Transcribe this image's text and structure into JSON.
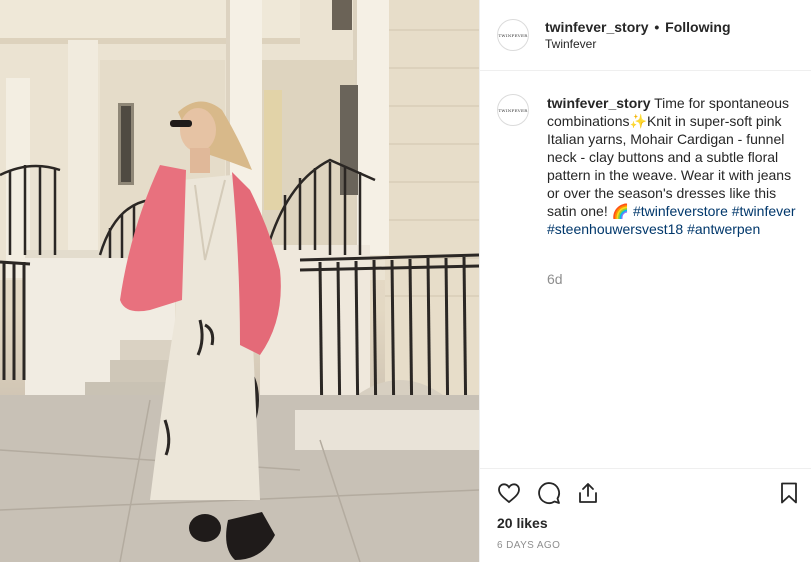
{
  "header": {
    "avatar_text": "TWINFEVER",
    "username": "twinfever_story",
    "separator": "•",
    "follow_status": "Following",
    "subtitle": "Twinfever"
  },
  "caption": {
    "author": "twinfever_story",
    "text_1": " Time for spontaneous combinations",
    "emoji_sparkle": "✨",
    "text_2": "Knit in super-soft pink Italian yarns, Mohair Cardigan - funnel neck - clay buttons and a subtle floral pattern in the weave. Wear it with jeans or over the season's dresses like this satin one! ",
    "emoji_rainbow": "🌈",
    "tags": [
      "#twinfeverstore",
      "#twinfever",
      "#steenhouwersvest18",
      "#antwerpen"
    ],
    "time_ago": "6d"
  },
  "actions": {
    "icons": [
      "heart-icon",
      "comment-icon",
      "share-icon",
      "bookmark-icon"
    ],
    "likes": "20 likes",
    "date": "6 DAYS AGO"
  },
  "colors": {
    "text": "#262626",
    "muted": "#8e8e8e",
    "hashtag": "#00376b",
    "border": "#efefef",
    "cardigan": "#e8717e",
    "dress": "#ece6d9"
  }
}
